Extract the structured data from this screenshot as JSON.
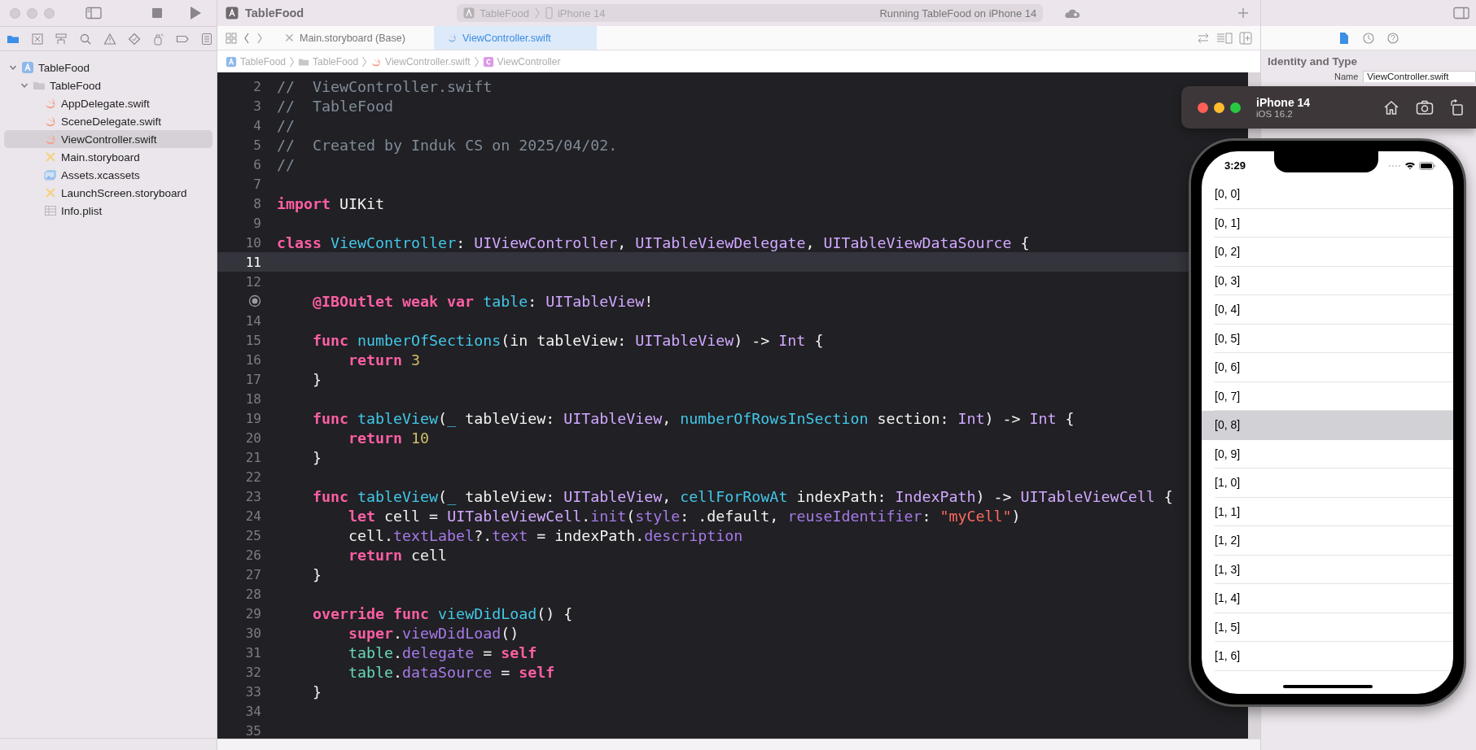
{
  "toolbar": {
    "project_title": "TableFood",
    "scheme": "TableFood",
    "destination": "iPhone 14",
    "status": "Running TableFood on iPhone 14"
  },
  "navigator": {
    "tabs": [
      {
        "kind": "folder",
        "selected": true
      },
      {
        "kind": "source",
        "selected": false
      },
      {
        "kind": "hierarchy",
        "selected": false
      },
      {
        "kind": "search",
        "selected": false
      },
      {
        "kind": "issue",
        "selected": false
      },
      {
        "kind": "test",
        "selected": false
      },
      {
        "kind": "debug",
        "selected": false
      },
      {
        "kind": "breakpoint",
        "selected": false
      },
      {
        "kind": "report",
        "selected": false
      }
    ],
    "tree": [
      {
        "label": "TableFood",
        "kind": "project",
        "expanded": true,
        "selected": false,
        "children": [
          {
            "label": "TableFood",
            "kind": "folder",
            "expanded": true,
            "selected": false,
            "children": [
              {
                "label": "AppDelegate.swift",
                "kind": "swift",
                "selected": false
              },
              {
                "label": "SceneDelegate.swift",
                "kind": "swift",
                "selected": false
              },
              {
                "label": "ViewController.swift",
                "kind": "swift",
                "selected": true
              },
              {
                "label": "Main.storyboard",
                "kind": "storyboard",
                "selected": false
              },
              {
                "label": "Assets.xcassets",
                "kind": "assets",
                "selected": false
              },
              {
                "label": "LaunchScreen.storyboard",
                "kind": "storyboard",
                "selected": false
              },
              {
                "label": "Info.plist",
                "kind": "plist",
                "selected": false
              }
            ]
          }
        ]
      }
    ]
  },
  "editor": {
    "tabs": [
      {
        "label": "Main.storyboard (Base)",
        "kind": "storyboard",
        "selected": false
      },
      {
        "label": "ViewController.swift",
        "kind": "swift",
        "selected": true
      }
    ],
    "breadcrumbs": [
      {
        "label": "TableFood",
        "kind": "project"
      },
      {
        "label": "TableFood",
        "kind": "folder"
      },
      {
        "label": "ViewController.swift",
        "kind": "swift"
      },
      {
        "label": "ViewController",
        "kind": "class"
      }
    ],
    "lines": [
      {
        "number": "2",
        "kind": "top",
        "tokens": [
          {
            "kind": "comment",
            "text": "//  ViewController.swift"
          }
        ]
      },
      {
        "number": "3",
        "kind": "top",
        "tokens": [
          {
            "kind": "comment",
            "text": "//  TableFood"
          }
        ]
      },
      {
        "number": "4",
        "kind": "top",
        "tokens": [
          {
            "kind": "comment",
            "text": "//"
          }
        ]
      },
      {
        "number": "5",
        "kind": "top",
        "tokens": [
          {
            "kind": "comment",
            "text": "//  Created by Induk CS on 2025/04/02."
          }
        ]
      },
      {
        "number": "6",
        "kind": "top",
        "tokens": [
          {
            "kind": "comment",
            "text": "//"
          }
        ]
      },
      {
        "number": "7",
        "current": false
      },
      {
        "number": "8",
        "kind": "top",
        "tokens": [
          {
            "kind": "keyword",
            "text": "import "
          },
          {
            "kind": "plain",
            "text": "UIKit"
          }
        ]
      },
      {
        "number": "9",
        "current": false
      },
      {
        "number": "10",
        "kind": "top",
        "tokens": [
          {
            "kind": "keyword",
            "text": "class "
          },
          {
            "kind": "decl",
            "text": "ViewController"
          },
          {
            "kind": "plain",
            "text": ": "
          },
          {
            "kind": "type",
            "text": "UIViewController"
          },
          {
            "kind": "plain",
            "text": ", "
          },
          {
            "kind": "type",
            "text": "UITableViewDelegate"
          },
          {
            "kind": "plain",
            "text": ", "
          },
          {
            "kind": "type",
            "text": "UITableViewDataSource"
          },
          {
            "kind": "plain",
            "text": " {"
          }
        ]
      },
      {
        "number": "11",
        "current": true
      },
      {
        "number": "12",
        "current": false
      },
      {
        "outlet": true,
        "kind": "nested",
        "tokens": [
          {
            "kind": "keyword",
            "text": "@IBOutlet weak var "
          },
          {
            "kind": "decl",
            "text": "table"
          },
          {
            "kind": "plain",
            "text": ": "
          },
          {
            "kind": "type",
            "text": "UITableView"
          },
          {
            "kind": "plain",
            "text": "!"
          }
        ]
      },
      {
        "number": "14",
        "current": false
      },
      {
        "number": "15",
        "kind": "nested",
        "tokens": [
          {
            "kind": "keyword",
            "text": "func "
          },
          {
            "kind": "decl",
            "text": "numberOfSections"
          },
          {
            "kind": "plain",
            "text": "(in tableView: "
          },
          {
            "kind": "type",
            "text": "UITableView"
          },
          {
            "kind": "plain",
            "text": ") -> "
          },
          {
            "kind": "type",
            "text": "Int"
          },
          {
            "kind": "plain",
            "text": " {"
          }
        ]
      },
      {
        "number": "16",
        "kind": "deep",
        "tokens": [
          {
            "kind": "keyword",
            "text": "return "
          },
          {
            "kind": "number",
            "text": "3"
          }
        ]
      },
      {
        "number": "17",
        "kind": "nested",
        "tokens": [
          {
            "kind": "plain",
            "text": "}"
          }
        ]
      },
      {
        "number": "18",
        "current": false
      },
      {
        "number": "19",
        "kind": "nested",
        "tokens": [
          {
            "kind": "keyword",
            "text": "func "
          },
          {
            "kind": "decl",
            "text": "tableView"
          },
          {
            "kind": "plain",
            "text": "("
          },
          {
            "kind": "decl",
            "text": "_"
          },
          {
            "kind": "plain",
            "text": " tableView: "
          },
          {
            "kind": "type",
            "text": "UITableView"
          },
          {
            "kind": "plain",
            "text": ", "
          },
          {
            "kind": "decl",
            "text": "numberOfRowsInSection"
          },
          {
            "kind": "plain",
            "text": " section: "
          },
          {
            "kind": "type",
            "text": "Int"
          },
          {
            "kind": "plain",
            "text": ") -> "
          },
          {
            "kind": "type",
            "text": "Int"
          },
          {
            "kind": "plain",
            "text": " {"
          }
        ]
      },
      {
        "number": "20",
        "kind": "deep",
        "tokens": [
          {
            "kind": "keyword",
            "text": "return "
          },
          {
            "kind": "number",
            "text": "10"
          }
        ]
      },
      {
        "number": "21",
        "kind": "nested",
        "tokens": [
          {
            "kind": "plain",
            "text": "}"
          }
        ]
      },
      {
        "number": "22",
        "current": false
      },
      {
        "number": "23",
        "kind": "nested",
        "tokens": [
          {
            "kind": "keyword",
            "text": "func "
          },
          {
            "kind": "decl",
            "text": "tableView"
          },
          {
            "kind": "plain",
            "text": "("
          },
          {
            "kind": "decl",
            "text": "_"
          },
          {
            "kind": "plain",
            "text": " tableView: "
          },
          {
            "kind": "type",
            "text": "UITableView"
          },
          {
            "kind": "plain",
            "text": ", "
          },
          {
            "kind": "decl",
            "text": "cellForRowAt"
          },
          {
            "kind": "plain",
            "text": " indexPath: "
          },
          {
            "kind": "type",
            "text": "IndexPath"
          },
          {
            "kind": "plain",
            "text": ") -> "
          },
          {
            "kind": "type",
            "text": "UITableViewCell"
          },
          {
            "kind": "plain",
            "text": " {"
          }
        ]
      },
      {
        "number": "24",
        "kind": "deep",
        "tokens": [
          {
            "kind": "keyword",
            "text": "let "
          },
          {
            "kind": "plain",
            "text": "cell = "
          },
          {
            "kind": "type",
            "text": "UITableViewCell"
          },
          {
            "kind": "plain",
            "text": "."
          },
          {
            "kind": "member",
            "text": "init"
          },
          {
            "kind": "plain",
            "text": "("
          },
          {
            "kind": "member",
            "text": "style"
          },
          {
            "kind": "plain",
            "text": ": .default, "
          },
          {
            "kind": "member",
            "text": "reuseIdentifier"
          },
          {
            "kind": "plain",
            "text": ": "
          },
          {
            "kind": "string",
            "text": "\"myCell\""
          },
          {
            "kind": "plain",
            "text": ")"
          }
        ]
      },
      {
        "number": "25",
        "kind": "deep",
        "tokens": [
          {
            "kind": "plain",
            "text": "cell."
          },
          {
            "kind": "member",
            "text": "textLabel"
          },
          {
            "kind": "plain",
            "text": "?."
          },
          {
            "kind": "member",
            "text": "text"
          },
          {
            "kind": "plain",
            "text": " = indexPath."
          },
          {
            "kind": "member",
            "text": "description"
          }
        ]
      },
      {
        "number": "26",
        "kind": "deep",
        "tokens": [
          {
            "kind": "keyword",
            "text": "return "
          },
          {
            "kind": "plain",
            "text": "cell"
          }
        ]
      },
      {
        "number": "27",
        "kind": "nested",
        "tokens": [
          {
            "kind": "plain",
            "text": "}"
          }
        ]
      },
      {
        "number": "28",
        "current": false
      },
      {
        "number": "29",
        "kind": "nested",
        "tokens": [
          {
            "kind": "keyword",
            "text": "override func "
          },
          {
            "kind": "decl",
            "text": "viewDidLoad"
          },
          {
            "kind": "plain",
            "text": "() {"
          }
        ]
      },
      {
        "number": "30",
        "kind": "deep",
        "tokens": [
          {
            "kind": "keyword",
            "text": "super"
          },
          {
            "kind": "plain",
            "text": "."
          },
          {
            "kind": "member",
            "text": "viewDidLoad"
          },
          {
            "kind": "plain",
            "text": "()"
          }
        ]
      },
      {
        "number": "31",
        "kind": "deep",
        "tokens": [
          {
            "kind": "project",
            "text": "table"
          },
          {
            "kind": "plain",
            "text": "."
          },
          {
            "kind": "member",
            "text": "delegate"
          },
          {
            "kind": "plain",
            "text": " = "
          },
          {
            "kind": "keyword",
            "text": "self"
          }
        ]
      },
      {
        "number": "32",
        "kind": "deep",
        "tokens": [
          {
            "kind": "project",
            "text": "table"
          },
          {
            "kind": "plain",
            "text": "."
          },
          {
            "kind": "member",
            "text": "dataSource"
          },
          {
            "kind": "plain",
            "text": " = "
          },
          {
            "kind": "keyword",
            "text": "self"
          }
        ]
      },
      {
        "number": "33",
        "kind": "nested",
        "tokens": [
          {
            "kind": "plain",
            "text": "}"
          }
        ]
      },
      {
        "number": "34",
        "current": false
      },
      {
        "number": "35",
        "current": false
      }
    ]
  },
  "inspector": {
    "tabs": [
      {
        "kind": "file",
        "selected": true
      },
      {
        "kind": "history",
        "selected": false
      },
      {
        "kind": "help",
        "selected": false
      }
    ],
    "section_title": "Identity and Type",
    "name_label": "Name",
    "name_value": "ViewController.swift"
  },
  "simulator": {
    "device": "iPhone 14",
    "os": "iOS 16.2",
    "time": "3:29",
    "rows": [
      {
        "label": "[0, 0]",
        "selected": false
      },
      {
        "label": "[0, 1]",
        "selected": false
      },
      {
        "label": "[0, 2]",
        "selected": false
      },
      {
        "label": "[0, 3]",
        "selected": false
      },
      {
        "label": "[0, 4]",
        "selected": false
      },
      {
        "label": "[0, 5]",
        "selected": false
      },
      {
        "label": "[0, 6]",
        "selected": false
      },
      {
        "label": "[0, 7]",
        "selected": false
      },
      {
        "label": "[0, 8]",
        "selected": true
      },
      {
        "label": "[0, 9]",
        "selected": false
      },
      {
        "label": "[1, 0]",
        "selected": false
      },
      {
        "label": "[1, 1]",
        "selected": false
      },
      {
        "label": "[1, 2]",
        "selected": false
      },
      {
        "label": "[1, 3]",
        "selected": false
      },
      {
        "label": "[1, 4]",
        "selected": false
      },
      {
        "label": "[1, 5]",
        "selected": false
      },
      {
        "label": "[1, 6]",
        "selected": false
      }
    ]
  }
}
